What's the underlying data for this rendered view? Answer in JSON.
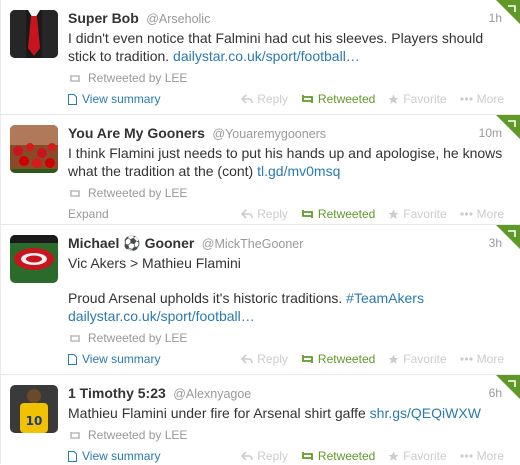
{
  "tweets": [
    {
      "fullname": "Super Bob",
      "username": "@Arseholic",
      "time": "1h",
      "lines": [
        "I didn't even notice that Falmini had cut his sleeves. Players should stick to tradition."
      ],
      "link": "dailystar.co.uk/sport/football…",
      "retweeted_by": "Retweeted by LEE",
      "summary_label": "View summary"
    },
    {
      "fullname": "You Are My Gooners",
      "username": "@Youaremygooners",
      "time": "10m",
      "lines": [
        "I think Flamini just needs to put his hands up and apologise, he knows what the tradition at the (cont)"
      ],
      "link": "tl.gd/mv0msq",
      "retweeted_by": "Retweeted by LEE",
      "summary_label": "Expand"
    },
    {
      "fullname": "Michael ⚽ Gooner",
      "username": "@MickTheGooner",
      "time": "3h",
      "line1": "Vic Akers > Mathieu Flamini",
      "line2": "Proud Arsenal upholds it's historic traditions.",
      "hashtag": "#TeamAkers",
      "link": "dailystar.co.uk/sport/football…",
      "retweeted_by": "Retweeted by LEE",
      "summary_label": "View summary"
    },
    {
      "fullname": "1 Timothy 5:23",
      "username": "@Alexnyagoe",
      "time": "6h",
      "lines": [
        "Mathieu Flamini under fire for Arsenal shirt gaffe"
      ],
      "link": "shr.gs/QEQiWXW",
      "retweeted_by": "Retweeted by LEE",
      "summary_label": "View summary"
    }
  ],
  "actions": {
    "reply": "Reply",
    "retweeted": "Retweeted",
    "favorite": "Favorite",
    "more": "More"
  },
  "colors": {
    "link": "#2a7ab0",
    "retweeted": "#609928",
    "muted": "#999999"
  }
}
